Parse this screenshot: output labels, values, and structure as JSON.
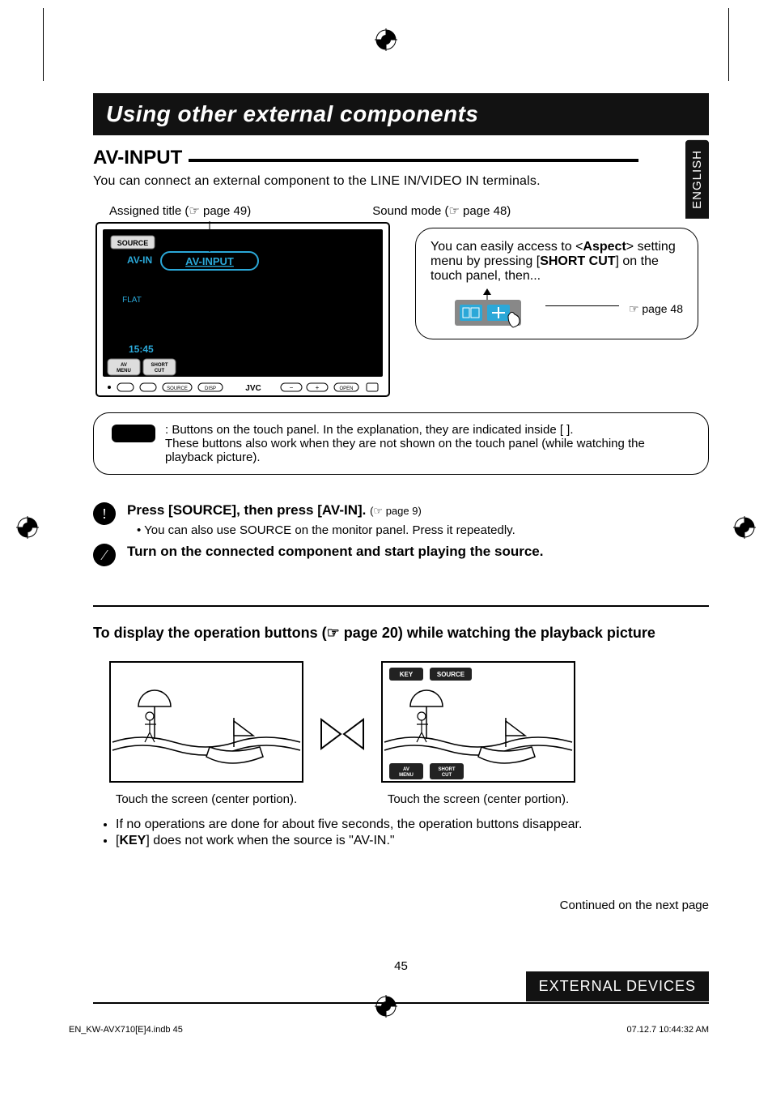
{
  "title_bar": "Using other external components",
  "language_tab": "ENGLISH",
  "section_heading": "AV-INPUT",
  "intro": "You can connect an external component to the LINE IN/VIDEO IN terminals.",
  "callouts": {
    "assigned_title": "Assigned title (☞ page 49)",
    "sound_mode": "Sound mode (☞ page 48)"
  },
  "device": {
    "source": "SOURCE",
    "avin": "AV-IN",
    "avinput": "AV-INPUT",
    "flat": "FLAT",
    "time": "15:45",
    "avmenu": "AV MENU",
    "shortcut": "SHORT CUT",
    "jvc": "JVC",
    "src_btn": "SOURCE",
    "disp_btn": "DISP",
    "open_btn": "OPEN"
  },
  "aspect_box": {
    "line1_a": "You can easily access to <",
    "line1_b": "Aspect",
    "line1_c": "> setting menu by pressing [",
    "line1_d": "SHORT CUT",
    "line1_e": "] on the touch panel, then...",
    "ref": "☞ page 48"
  },
  "legend": {
    "text1": ":  Buttons on the touch panel. In the explanation, they are indicated inside [       ].",
    "text2": "These buttons also work when they are not shown on the touch panel (while watching the playback picture)."
  },
  "steps": {
    "s1": {
      "num": "!",
      "main": "Press [SOURCE], then press [AV-IN].",
      "ref": "(☞ page 9)",
      "sub": "•  You can also use SOURCE on the monitor panel. Press it repeatedly."
    },
    "s2": {
      "num": "⁄",
      "main": "Turn on the connected component and start playing the source."
    }
  },
  "subhead": {
    "a": "To display the operation buttons (",
    "b": "☞ page 20) while watching the playback picture"
  },
  "screens": {
    "key": "KEY",
    "source": "SOURCE",
    "avmenu": "AV MENU",
    "shortcut": "SHORT CUT",
    "cap1": "Touch the screen (center portion).",
    "cap2": "Touch the screen (center portion)."
  },
  "notes": {
    "n1": "If no operations are done for about five seconds, the operation buttons disappear.",
    "n2_a": "[",
    "n2_b": "KEY",
    "n2_c": "] does not work when the source is \"AV-IN.\""
  },
  "continued": "Continued on the next page",
  "page_number": "45",
  "footer_bar": "EXTERNAL DEVICES",
  "doc_footer": {
    "file": "EN_KW-AVX710[E]4.indb   45",
    "date": "07.12.7   10:44:32 AM"
  }
}
